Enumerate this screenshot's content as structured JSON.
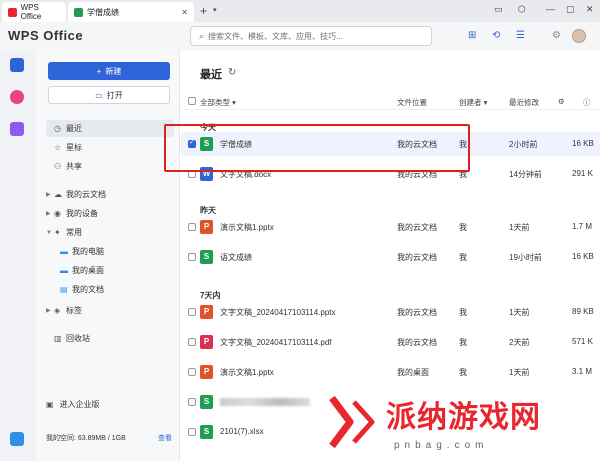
{
  "titlebar": {
    "tabs": [
      {
        "label": "WPS Office",
        "color": "#e8262e"
      },
      {
        "label": "学僧成绩",
        "color": "#1f9d55"
      }
    ],
    "add_tab": "+",
    "add_dropdown": "▾"
  },
  "header": {
    "brand": "WPS Office",
    "search_placeholder": "搜索文件、模板、文库、应用、技巧..."
  },
  "sidebar": {
    "new_label": "新建",
    "open_label": "打开",
    "items": [
      {
        "label": "最近",
        "icon": "clock-icon"
      },
      {
        "label": "星标",
        "icon": "star-icon"
      },
      {
        "label": "共享",
        "icon": "share-icon"
      },
      {
        "label": "我的云文档",
        "icon": "cloud-icon"
      },
      {
        "label": "我的设备",
        "icon": "device-icon"
      },
      {
        "label": "常用",
        "icon": "pin-icon"
      },
      {
        "label": "我的电脑",
        "icon": "computer-icon"
      },
      {
        "label": "我的桌面",
        "icon": "desktop-icon"
      },
      {
        "label": "我的文档",
        "icon": "document-icon"
      },
      {
        "label": "标签",
        "icon": "tag-icon"
      },
      {
        "label": "回收站",
        "icon": "trash-icon"
      }
    ],
    "enterprise_label": "进入企业版",
    "storage_label": "我的空间: 63.89MB / 1GB",
    "storage_view": "查看"
  },
  "main": {
    "title": "最近",
    "columns": {
      "type": "全部类型",
      "location": "文件位置",
      "creator": "创建者",
      "modified": "最近修改"
    },
    "groups": [
      {
        "label": "今天",
        "files": [
          {
            "name": "学僧成绩",
            "type": "S",
            "color": "#1f9d55",
            "location": "我的云文档",
            "creator": "我",
            "modified": "2小时前",
            "size": "16 KB",
            "selected": true
          },
          {
            "name": "文字文稿.docx",
            "type": "W",
            "color": "#2f64d8",
            "location": "我的云文档",
            "creator": "我",
            "modified": "14分钟前",
            "size": "291 K"
          }
        ]
      },
      {
        "label": "昨天",
        "files": [
          {
            "name": "演示文稿1.pptx",
            "type": "P",
            "color": "#e0522a",
            "location": "我的云文档",
            "creator": "我",
            "modified": "1天前",
            "size": "1.7 M"
          },
          {
            "name": "语文成绩",
            "type": "S",
            "color": "#1f9d55",
            "location": "我的云文档",
            "creator": "我",
            "modified": "19小时前",
            "size": "16 KB"
          }
        ]
      },
      {
        "label": "7天内",
        "files": [
          {
            "name": "文字文稿_20240417103114.pptx",
            "type": "P",
            "color": "#e0522a",
            "location": "我的云文档",
            "creator": "我",
            "modified": "1天前",
            "size": "89 KB"
          },
          {
            "name": "文字文稿_20240417103114.pdf",
            "type": "P",
            "color": "#d9304f",
            "location": "我的云文档",
            "creator": "我",
            "modified": "2天前",
            "size": "571 K"
          },
          {
            "name": "演示文稿1.pptx",
            "type": "P",
            "color": "#e0522a",
            "location": "我的桌面",
            "creator": "我",
            "modified": "1天前",
            "size": "3.1 M"
          },
          {
            "name": "",
            "type": "S",
            "color": "#1f9d55",
            "location": "",
            "creator": "",
            "modified": "",
            "size": ""
          },
          {
            "name": "2101(7).xlsx",
            "type": "S",
            "color": "#1f9d55",
            "location": "",
            "creator": "",
            "modified": "",
            "size": ""
          }
        ]
      }
    ]
  },
  "watermark": {
    "text": "派纳游戏网",
    "sub": "pnbag.com"
  }
}
